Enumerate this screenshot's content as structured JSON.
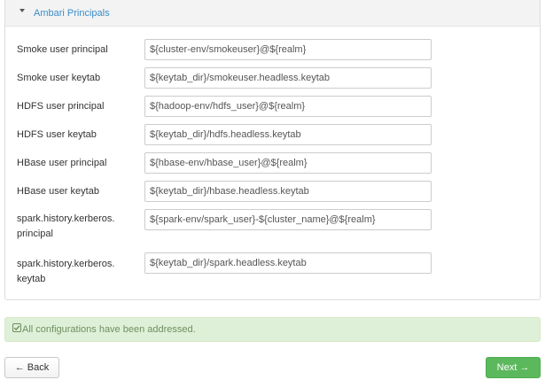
{
  "panel": {
    "title": "Ambari Principals"
  },
  "fields": [
    {
      "label": "Smoke user principal",
      "value": "${cluster-env/smokeuser}@${realm}"
    },
    {
      "label": "Smoke user keytab",
      "value": "${keytab_dir}/smokeuser.headless.keytab"
    },
    {
      "label": "HDFS user principal",
      "value": "${hadoop-env/hdfs_user}@${realm}"
    },
    {
      "label": "HDFS user keytab",
      "value": "${keytab_dir}/hdfs.headless.keytab"
    },
    {
      "label": "HBase user principal",
      "value": "${hbase-env/hbase_user}@${realm}"
    },
    {
      "label": "HBase user keytab",
      "value": "${keytab_dir}/hbase.headless.keytab"
    },
    {
      "label": "spark.history.kerberos.\nprincipal",
      "value": "${spark-env/spark_user}-${cluster_name}@${realm}"
    },
    {
      "label": "spark.history.kerberos.\nkeytab",
      "value": "${keytab_dir}/spark.headless.keytab"
    }
  ],
  "alert": {
    "text": "All configurations have been addressed.",
    "icon": "check-square-icon"
  },
  "buttons": {
    "back_label": "← Back",
    "next_label": "Next →"
  }
}
